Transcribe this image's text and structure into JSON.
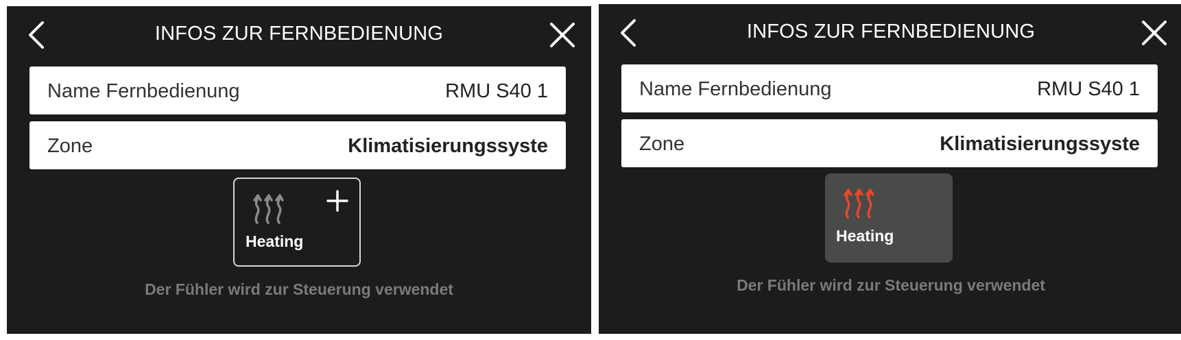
{
  "screens": [
    {
      "title": "INFOS ZUR FERNBEDIENUNG",
      "rows": [
        {
          "label": "Name Fernbedienung",
          "value": "RMU S40 1"
        },
        {
          "label": "Zone",
          "value": "Klimatisierungssyste"
        }
      ],
      "tile": {
        "label": "Heating",
        "icon": "heating-icon",
        "action_icon": "plus-icon",
        "state": "unselected",
        "icon_color": "#8a8a8a"
      },
      "footnote": "Der Fühler wird zur Steuerung verwendet"
    },
    {
      "title": "INFOS ZUR FERNBEDIENUNG",
      "rows": [
        {
          "label": "Name Fernbedienung",
          "value": "RMU S40 1"
        },
        {
          "label": "Zone",
          "value": "Klimatisierungssyste"
        }
      ],
      "tile": {
        "label": "Heating",
        "icon": "heating-icon",
        "state": "selected",
        "icon_color": "#e8462a"
      },
      "footnote": "Der Fühler wird zur Steuerung verwendet"
    }
  ],
  "colors": {
    "background": "#1c1c1c",
    "row_background": "#ffffff",
    "selected_tile": "#4a4a4a",
    "accent_heating": "#e8462a",
    "footnote": "#7a7a7a"
  }
}
